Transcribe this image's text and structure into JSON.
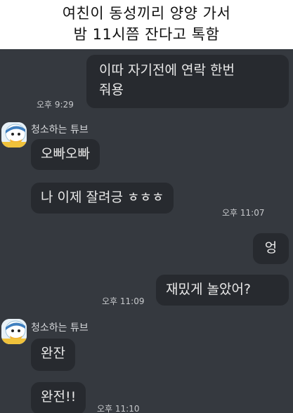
{
  "caption": {
    "line1": "여친이 동성끼리 양양 가서",
    "line2": "밤 11시쯤 잔다고 톡함"
  },
  "messages": {
    "m1": {
      "text": "이따 자기전에 연락 한번\n줘용",
      "time": "오후 9:29"
    },
    "sender1": "청소하는 튜브",
    "m2": {
      "text": "오빠오빠"
    },
    "m3": {
      "text": "나 이제 잘려긍 ㅎㅎㅎ",
      "time": "오후 11:07"
    },
    "m4": {
      "text": "엉"
    },
    "m5": {
      "text": "재밌게 놀았어?",
      "time": "오후 11:09"
    },
    "sender2": "청소하는 튜브",
    "m6": {
      "text": "완잔"
    },
    "m7": {
      "text": "완전!!",
      "time": "오후 11:10"
    }
  },
  "icons": {
    "avatar": "tube-duck-avatar-icon"
  },
  "colors": {
    "chat_background": "#35393f",
    "bubble": "#272a2f",
    "bubble_text": "#e9e9e9"
  }
}
